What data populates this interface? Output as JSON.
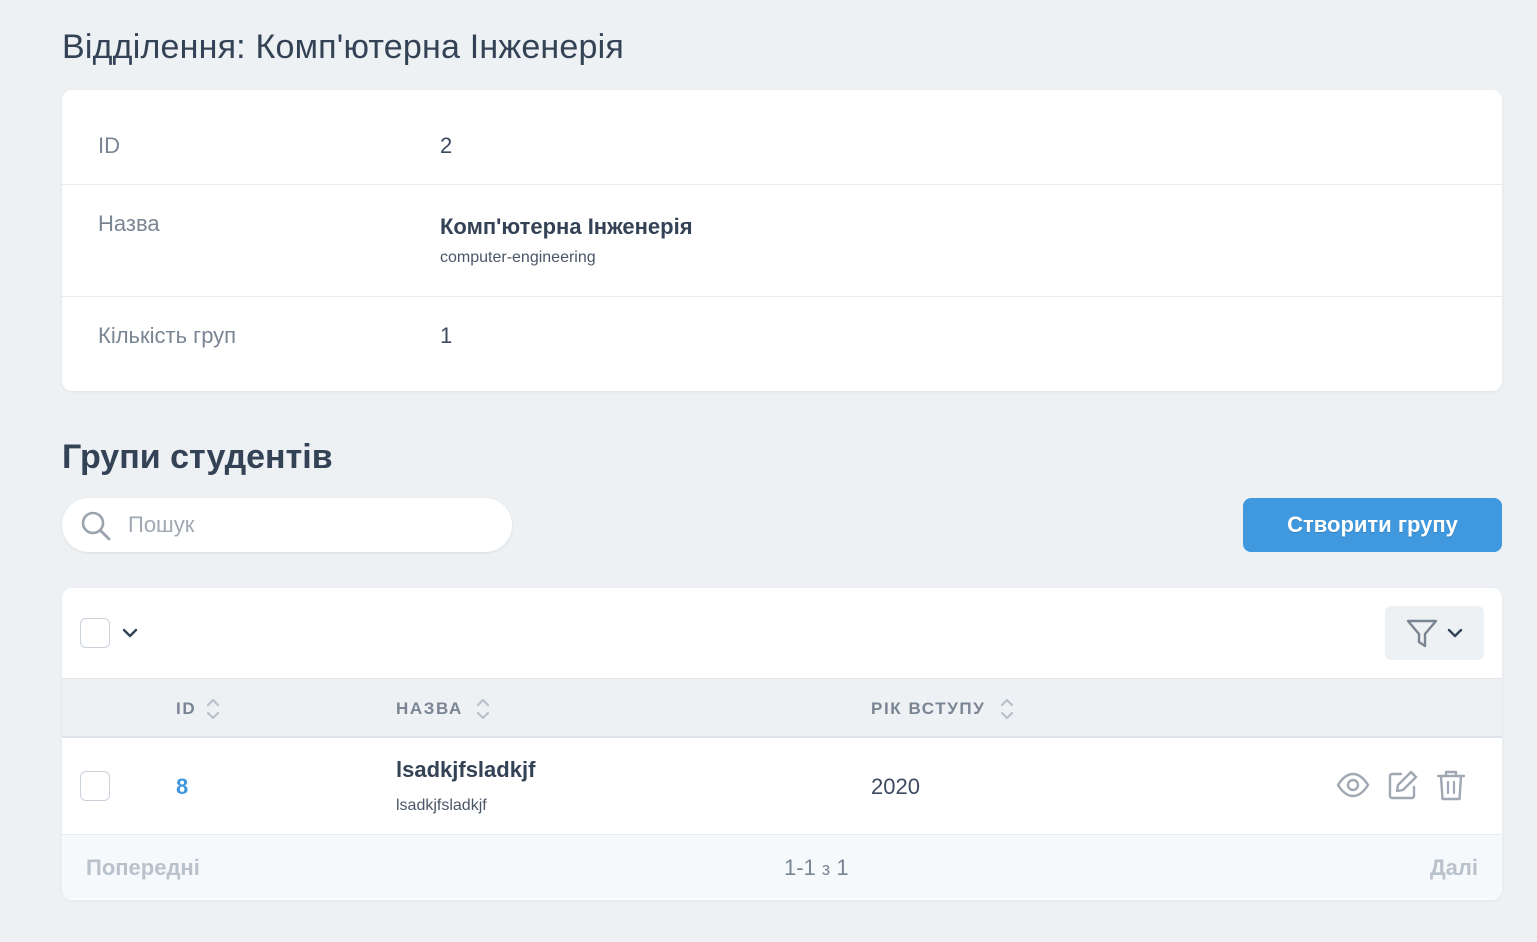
{
  "page": {
    "title": "Відділення: Комп'ютерна Інженерія"
  },
  "details": {
    "id_label": "ID",
    "id_value": "2",
    "name_label": "Назва",
    "name_value": "Комп'ютерна Інженерія",
    "name_slug": "computer-engineering",
    "groups_count_label": "Кількість груп",
    "groups_count_value": "1"
  },
  "groups": {
    "section_title": "Групи студентів",
    "search_placeholder": "Пошук",
    "create_button": "Створити групу",
    "columns": [
      "ID",
      "НАЗВА",
      "РІК ВСТУПУ"
    ],
    "rows": [
      {
        "id": "8",
        "name": "lsadkjfsladkjf",
        "slug": "lsadkjfsladkjf",
        "year": "2020"
      }
    ],
    "pagination": {
      "prev": "Попередні",
      "next": "Далі",
      "range": "1-1",
      "of": "з",
      "total": "1"
    }
  },
  "icons": {
    "search": "search-icon",
    "chevron": "chevron-down-icon",
    "filter": "filter-icon",
    "sort": "sort-icon",
    "view": "eye-icon",
    "edit": "edit-icon",
    "delete": "trash-icon"
  },
  "colors": {
    "accent": "#4099de",
    "link": "#3f97e0",
    "background": "#eef1f4"
  }
}
